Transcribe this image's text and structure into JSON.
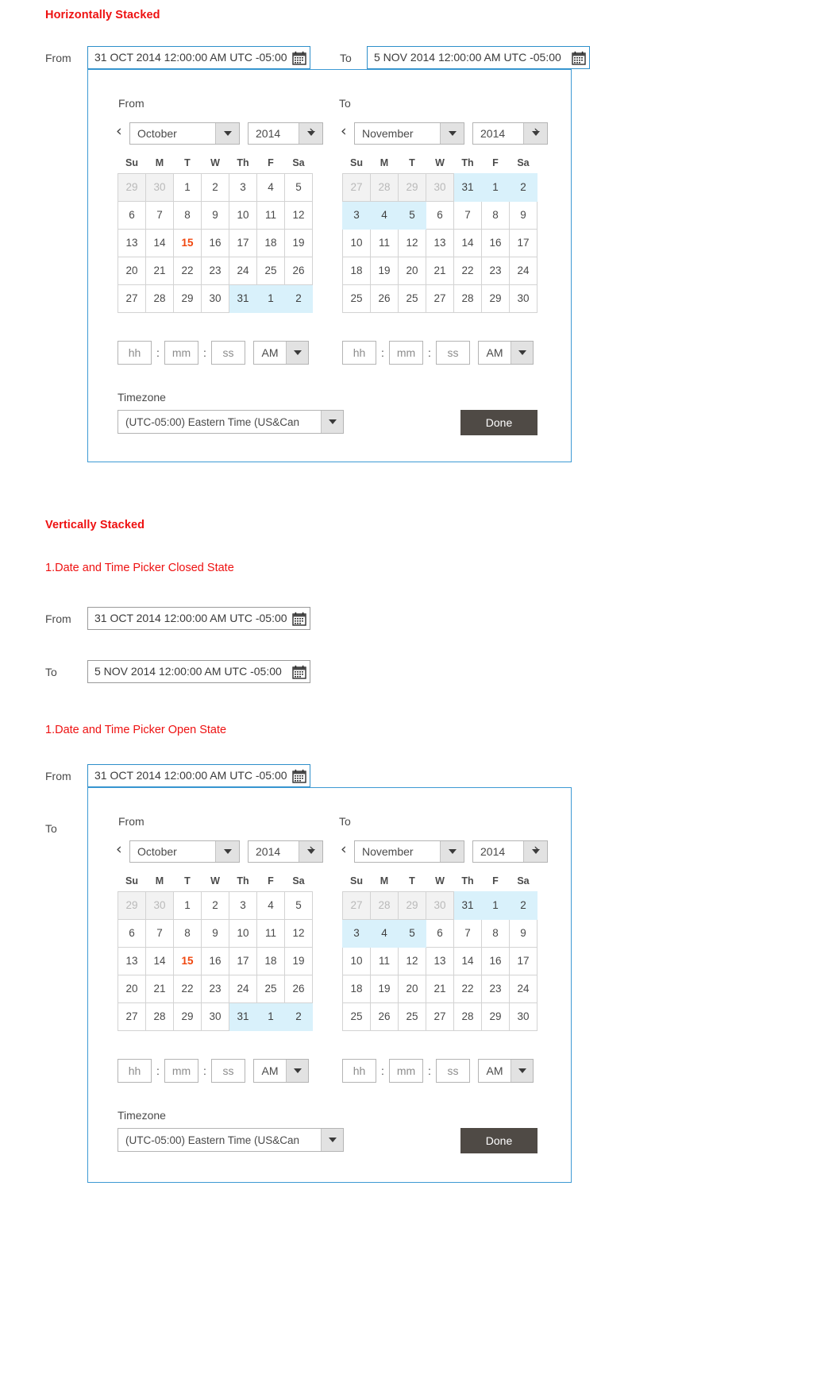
{
  "sections": {
    "horizontal_title": "Horizontally Stacked",
    "vertical_title": "Vertically Stacked",
    "closed_state_title": "1.Date and Time Picker Closed State",
    "open_state_title": "1.Date and Time Picker Open State"
  },
  "labels": {
    "from": "From",
    "to": "To",
    "timezone": "Timezone",
    "done": "Done"
  },
  "fields": {
    "from_value": "31 OCT 2014 12:00:00 AM UTC -05:00",
    "to_value": "5 NOV 2014 12:00:00 AM UTC -05:00",
    "calendar_icon": "calendar-icon"
  },
  "picker": {
    "from_month": "October",
    "from_year": "2014",
    "to_month": "November",
    "to_year": "2014",
    "prev_arrow": "‹",
    "next_arrow": "›",
    "weekdays": [
      "Su",
      "M",
      "T",
      "W",
      "Th",
      "F",
      "Sa"
    ],
    "from_weeks": [
      [
        {
          "d": "29",
          "t": "other"
        },
        {
          "d": "30",
          "t": "other"
        },
        {
          "d": "1",
          "t": ""
        },
        {
          "d": "2",
          "t": ""
        },
        {
          "d": "3",
          "t": ""
        },
        {
          "d": "4",
          "t": ""
        },
        {
          "d": "5",
          "t": ""
        }
      ],
      [
        {
          "d": "6",
          "t": ""
        },
        {
          "d": "7",
          "t": ""
        },
        {
          "d": "8",
          "t": ""
        },
        {
          "d": "9",
          "t": ""
        },
        {
          "d": "10",
          "t": ""
        },
        {
          "d": "11",
          "t": ""
        },
        {
          "d": "12",
          "t": ""
        }
      ],
      [
        {
          "d": "13",
          "t": ""
        },
        {
          "d": "14",
          "t": ""
        },
        {
          "d": "15",
          "t": "today"
        },
        {
          "d": "16",
          "t": ""
        },
        {
          "d": "17",
          "t": ""
        },
        {
          "d": "18",
          "t": ""
        },
        {
          "d": "19",
          "t": ""
        }
      ],
      [
        {
          "d": "20",
          "t": ""
        },
        {
          "d": "21",
          "t": ""
        },
        {
          "d": "22",
          "t": ""
        },
        {
          "d": "23",
          "t": ""
        },
        {
          "d": "24",
          "t": ""
        },
        {
          "d": "25",
          "t": ""
        },
        {
          "d": "26",
          "t": ""
        }
      ],
      [
        {
          "d": "27",
          "t": ""
        },
        {
          "d": "28",
          "t": ""
        },
        {
          "d": "29",
          "t": ""
        },
        {
          "d": "30",
          "t": ""
        },
        {
          "d": "31",
          "t": "sel-range"
        },
        {
          "d": "1",
          "t": "sel-range"
        },
        {
          "d": "2",
          "t": "sel-range"
        }
      ]
    ],
    "to_weeks": [
      [
        {
          "d": "27",
          "t": "other"
        },
        {
          "d": "28",
          "t": "other"
        },
        {
          "d": "29",
          "t": "other"
        },
        {
          "d": "30",
          "t": "other"
        },
        {
          "d": "31",
          "t": "sel-range"
        },
        {
          "d": "1",
          "t": "sel-range"
        },
        {
          "d": "2",
          "t": "sel-range"
        }
      ],
      [
        {
          "d": "3",
          "t": "sel-range"
        },
        {
          "d": "4",
          "t": "sel-range"
        },
        {
          "d": "5",
          "t": "sel-range"
        },
        {
          "d": "6",
          "t": ""
        },
        {
          "d": "7",
          "t": ""
        },
        {
          "d": "8",
          "t": ""
        },
        {
          "d": "9",
          "t": ""
        }
      ],
      [
        {
          "d": "10",
          "t": ""
        },
        {
          "d": "11",
          "t": ""
        },
        {
          "d": "12",
          "t": ""
        },
        {
          "d": "13",
          "t": ""
        },
        {
          "d": "14",
          "t": ""
        },
        {
          "d": "16",
          "t": ""
        },
        {
          "d": "17",
          "t": ""
        }
      ],
      [
        {
          "d": "18",
          "t": ""
        },
        {
          "d": "19",
          "t": ""
        },
        {
          "d": "20",
          "t": ""
        },
        {
          "d": "21",
          "t": ""
        },
        {
          "d": "22",
          "t": ""
        },
        {
          "d": "23",
          "t": ""
        },
        {
          "d": "24",
          "t": ""
        }
      ],
      [
        {
          "d": "25",
          "t": ""
        },
        {
          "d": "26",
          "t": ""
        },
        {
          "d": "25",
          "t": ""
        },
        {
          "d": "27",
          "t": ""
        },
        {
          "d": "28",
          "t": ""
        },
        {
          "d": "29",
          "t": ""
        },
        {
          "d": "30",
          "t": ""
        }
      ]
    ],
    "time": {
      "hh_placeholder": "hh",
      "mm_placeholder": "mm",
      "ss_placeholder": "ss",
      "colon": ":",
      "meridiem": "AM"
    },
    "timezone_value": "(UTC-05:00) Eastern Time (US&Can"
  },
  "colors": {
    "accent_red": "#ee1111",
    "panel_border_blue": "#3d9ad4",
    "selection_blue": "#d9f1fb",
    "today_orange": "#f0470f",
    "done_button": "#4f4a45"
  }
}
